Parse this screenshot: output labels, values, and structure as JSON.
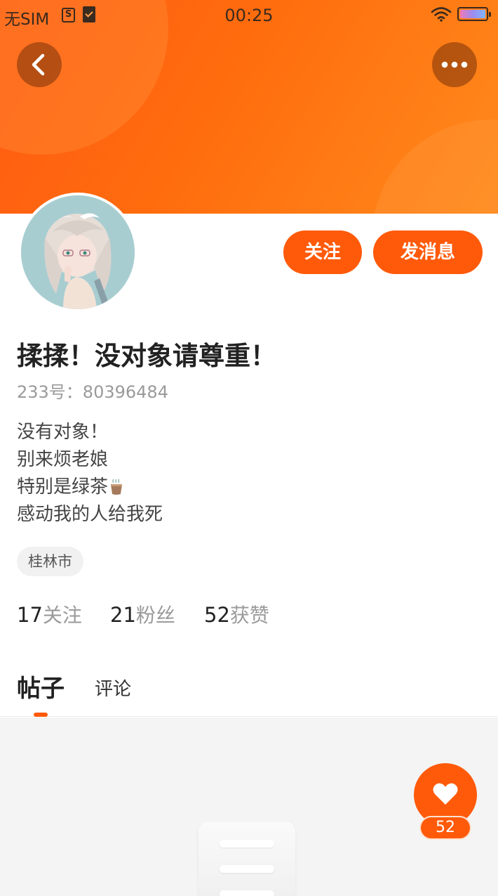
{
  "status_bar": {
    "carrier": "无SIM",
    "time": "00:25"
  },
  "header": {
    "gradient_colors": [
      "#ff5a12",
      "#ff8a1c"
    ],
    "back_icon": "chevron-left-icon",
    "more_icon": "more-dots-icon"
  },
  "actions": {
    "follow_label": "关注",
    "message_label": "发消息",
    "accent_color": "#ff5a0a"
  },
  "profile": {
    "name": "揉揉！没对象请尊重！",
    "id_line": "233号：80396484",
    "bio": [
      "没有对象！",
      "别来烦老娘",
      "特别是绿茶",
      "感动我的人给我死"
    ],
    "bio_emoji": "tea-cup-icon",
    "location": "桂林市"
  },
  "stats": [
    {
      "value": "17",
      "label": "关注"
    },
    {
      "value": "21",
      "label": "粉丝"
    },
    {
      "value": "52",
      "label": "获赞"
    }
  ],
  "tabs": [
    {
      "label": "帖子",
      "active": true
    },
    {
      "label": "评论",
      "active": false
    }
  ],
  "like_fab": {
    "icon": "heart-icon",
    "count": "52"
  }
}
